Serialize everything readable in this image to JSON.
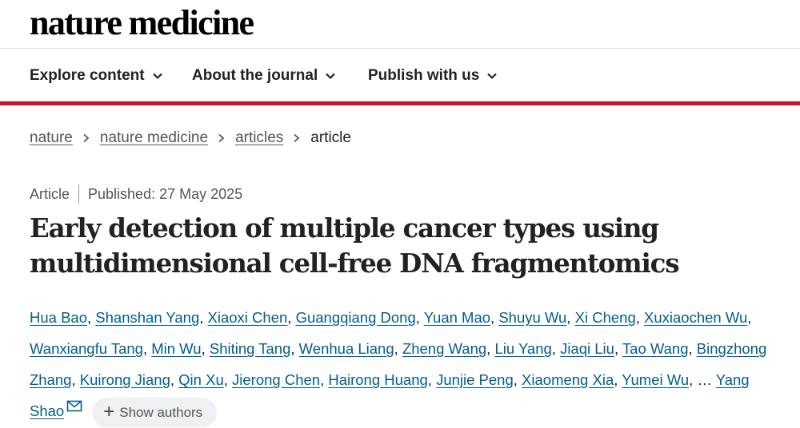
{
  "masthead": {
    "logo_text": "nature medicine"
  },
  "nav": {
    "items": [
      {
        "label": "Explore content"
      },
      {
        "label": "About the journal"
      },
      {
        "label": "Publish with us"
      }
    ]
  },
  "breadcrumb": {
    "items": [
      "nature",
      "nature medicine",
      "articles"
    ],
    "current": "article",
    "separator": "›"
  },
  "article": {
    "type": "Article",
    "published": "Published: 27 May 2025",
    "title_line1": "Early detection of multiple cancer types using",
    "title_line2": "multidimensional cell-free DNA fragmentomics",
    "authors": [
      "Hua Bao",
      "Shanshan Yang",
      "Xiaoxi Chen",
      "Guangqiang Dong",
      "Yuan Mao",
      "Shuyu Wu",
      "Xi Cheng",
      "Xuxiaochen Wu",
      "Wanxiangfu Tang",
      "Min Wu",
      "Shiting Tang",
      "Wenhua Liang",
      "Zheng Wang",
      "Liu Yang",
      "Jiaqi Liu",
      "Tao Wang",
      "Bingzhong Zhang",
      "Kuirong Jiang",
      "Qin Xu",
      "Jierong Chen",
      "Hairong Huang",
      "Junjie Peng",
      "Xiaomeng Xia",
      "Yumei Wu"
    ],
    "ellipsis": "…",
    "last_author": "Yang Shao",
    "show_authors_label": "Show authors"
  },
  "colors": {
    "link": "#025e8d",
    "accent_rule": "#cc0e2a"
  },
  "icons": {
    "nav_chevron": "chevron-down-icon",
    "crumb_separator": "chevron-right-icon",
    "corresponding": "mail-icon",
    "expand": "plus-icon"
  }
}
